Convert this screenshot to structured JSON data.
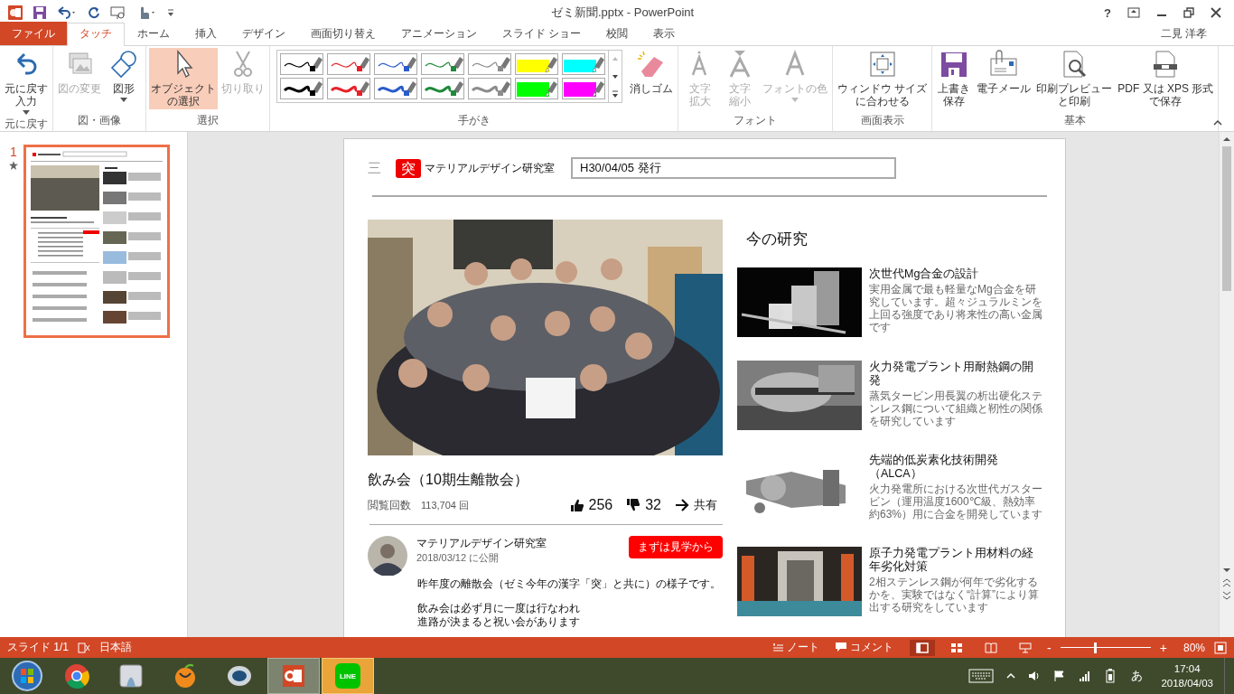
{
  "window": {
    "title": "ゼミ新聞.pptx - PowerPoint",
    "help": "?",
    "user": "二見 洋孝"
  },
  "tabs": [
    {
      "label": "ファイル",
      "kind": "file",
      "selected": false
    },
    {
      "label": "タッチ",
      "kind": "tab",
      "selected": true
    },
    {
      "label": "ホーム",
      "kind": "tab",
      "selected": false
    },
    {
      "label": "挿入",
      "kind": "tab",
      "selected": false
    },
    {
      "label": "デザイン",
      "kind": "tab",
      "selected": false
    },
    {
      "label": "画面切り替え",
      "kind": "tab",
      "selected": false
    },
    {
      "label": "アニメーション",
      "kind": "tab",
      "selected": false
    },
    {
      "label": "スライド ショー",
      "kind": "tab",
      "selected": false
    },
    {
      "label": "校閲",
      "kind": "tab",
      "selected": false
    },
    {
      "label": "表示",
      "kind": "tab",
      "selected": false
    }
  ],
  "ribbon": [
    {
      "name": "元に戻す",
      "buttons": [
        {
          "kind": "undo",
          "lines": [
            "元に戻す",
            "入力"
          ],
          "caret": true,
          "disabled": false,
          "selected": false
        }
      ]
    },
    {
      "name": "図・画像",
      "buttons": [
        {
          "kind": "picture",
          "lines": [
            "図の変更"
          ],
          "caret": false,
          "disabled": true,
          "selected": false
        },
        {
          "kind": "shape",
          "lines": [
            "図形"
          ],
          "caret": true,
          "disabled": false,
          "selected": false
        }
      ]
    },
    {
      "name": "選択",
      "buttons": [
        {
          "kind": "select",
          "lines": [
            "オブジェクト",
            "の選択"
          ],
          "caret": false,
          "disabled": false,
          "selected": true
        },
        {
          "kind": "cut",
          "lines": [
            "切り取り"
          ],
          "caret": false,
          "disabled": true,
          "selected": false
        }
      ]
    },
    {
      "name": "手がき",
      "pens": [
        {
          "color": "#000000",
          "kind": "pen",
          "thick": false
        },
        {
          "color": "#e8202a",
          "kind": "pen",
          "thick": false
        },
        {
          "color": "#2a5cc8",
          "kind": "pen",
          "thick": false
        },
        {
          "color": "#1e8a3a",
          "kind": "pen",
          "thick": false
        },
        {
          "color": "#8c8c8c",
          "kind": "pen",
          "thick": false
        },
        {
          "color": "#ffff00",
          "kind": "highlighter",
          "thick": false
        },
        {
          "color": "#00ffff",
          "kind": "highlighter",
          "thick": false
        },
        {
          "color": "#000000",
          "kind": "pen",
          "thick": true
        },
        {
          "color": "#e8202a",
          "kind": "pen",
          "thick": true
        },
        {
          "color": "#2a5cc8",
          "kind": "pen",
          "thick": true
        },
        {
          "color": "#1e8a3a",
          "kind": "pen",
          "thick": true
        },
        {
          "color": "#8c8c8c",
          "kind": "pen",
          "thick": true
        },
        {
          "color": "#00ff00",
          "kind": "highlighter",
          "thick": true
        },
        {
          "color": "#ff00ff",
          "kind": "highlighter",
          "thick": true
        }
      ],
      "buttons": [
        {
          "kind": "eraser",
          "lines": [
            "消しゴム"
          ],
          "caret": false,
          "disabled": false,
          "selected": false
        }
      ]
    },
    {
      "name": "フォント",
      "buttons": [
        {
          "kind": "grow",
          "lines": [
            "文字",
            "拡大"
          ],
          "caret": false,
          "disabled": true,
          "selected": false
        },
        {
          "kind": "shrink",
          "lines": [
            "文字",
            "縮小"
          ],
          "caret": false,
          "disabled": true,
          "selected": false
        },
        {
          "kind": "fontcolor",
          "lines": [
            "フォントの色"
          ],
          "caret": true,
          "disabled": true,
          "selected": false
        }
      ]
    },
    {
      "name": "画面表示",
      "buttons": [
        {
          "kind": "fit",
          "lines": [
            "ウィンドウ サイズ",
            "に合わせる"
          ],
          "caret": false,
          "disabled": false,
          "selected": false
        }
      ]
    },
    {
      "name": "基本",
      "buttons": [
        {
          "kind": "save",
          "lines": [
            "上書き",
            "保存"
          ],
          "caret": false,
          "disabled": false,
          "selected": false
        },
        {
          "kind": "mail",
          "lines": [
            "電子メール"
          ],
          "caret": false,
          "disabled": false,
          "selected": false
        },
        {
          "kind": "preview",
          "lines": [
            "印刷プレビュー",
            "と印刷"
          ],
          "caret": false,
          "disabled": false,
          "selected": false
        },
        {
          "kind": "pdf",
          "lines": [
            "PDF 又は XPS 形式",
            "で保存"
          ],
          "caret": false,
          "disabled": false,
          "selected": false
        }
      ]
    }
  ],
  "thumbnails": [
    {
      "number": "1",
      "selected": true
    }
  ],
  "slide": {
    "menu": "三",
    "logo": "突",
    "lab": "マテリアルデザイン研究室",
    "issue": "H30/04/05 発行",
    "article": {
      "title": "飲み会（10期生離散会）",
      "views_label": "閲覧回数",
      "views": "113,704 回",
      "likes": "256",
      "dislikes": "32",
      "share": "共有",
      "author": "マテリアルデザイン研究室",
      "published": "2018/03/12 に公開",
      "cta": "まずは見学から",
      "body": [
        "昨年度の離散会（ゼミ今年の漢字「突」と共に）の様子です。",
        "飲み会は必ず月に一度は行なわれ",
        "進路が決まると祝い会があります"
      ]
    },
    "research_heading": "今の研究",
    "research": [
      {
        "title": "次世代Mg合金の設計",
        "desc": "実用金属で最も軽量なMg合金を研究しています。超々ジュラルミンを上回る強度であり将来性の高い金属です"
      },
      {
        "title": "火力発電プラント用耐熱鋼の開発",
        "desc": "蒸気タービン用長翼の析出硬化ステンレス鋼について組織と靭性の関係を研究しています"
      },
      {
        "title": "先端的低炭素化技術開発（ALCA）",
        "desc": "火力発電所における次世代ガスタービン（運用温度1600℃級、熱効率約63%）用に合金を開発しています"
      },
      {
        "title": "原子力発電プラント用材料の経年劣化対策",
        "desc": "2相ステンレス鋼が何年で劣化するかを、実験ではなく“計算”により算出する研究をしています"
      }
    ]
  },
  "status_bar": {
    "slide": "スライド 1/1",
    "language": "日本語",
    "notes": "ノート",
    "comments": "コメント",
    "views": [
      {
        "kind": "normal",
        "selected": true
      },
      {
        "kind": "sorter",
        "selected": false
      },
      {
        "kind": "reading",
        "selected": false
      },
      {
        "kind": "show",
        "selected": false
      }
    ],
    "zoom_out": "-",
    "zoom_in": "+",
    "zoom": {
      "level": 0.37
    },
    "zoom_text": "80%"
  },
  "taskbar": {
    "apps": [
      {
        "kind": "chrome",
        "active": false,
        "flashing": false
      },
      {
        "kind": "app",
        "active": false,
        "flashing": false
      },
      {
        "kind": "fruit",
        "active": false,
        "flashing": false
      },
      {
        "kind": "r",
        "active": false,
        "flashing": false
      },
      {
        "kind": "powerpoint",
        "active": true,
        "flashing": false
      },
      {
        "kind": "line",
        "label": "LINE",
        "active": false,
        "flashing": true
      }
    ],
    "ime": "あ",
    "time": "17:04",
    "date": "2018/04/03"
  }
}
